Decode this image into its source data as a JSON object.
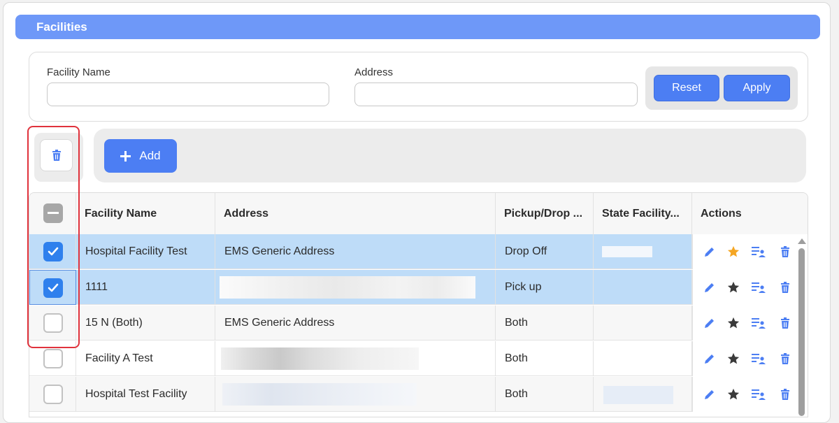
{
  "header": {
    "title": "Facilities"
  },
  "filters": {
    "facility_name_label": "Facility Name",
    "facility_name_value": "",
    "address_label": "Address",
    "address_value": "",
    "reset_label": "Reset",
    "apply_label": "Apply"
  },
  "toolbar": {
    "add_label": "Add"
  },
  "table": {
    "columns": [
      "Facility Name",
      "Address",
      "Pickup/Drop ...",
      "State Facility...",
      "Actions"
    ],
    "rows": [
      {
        "checked": true,
        "name": "Hospital Facility Test",
        "address": "EMS Generic Address",
        "pickup": "Drop Off",
        "favorite": true
      },
      {
        "checked": true,
        "name": "1111",
        "address": "",
        "pickup": "Pick up",
        "favorite": false
      },
      {
        "checked": false,
        "name": "15 N (Both)",
        "address": "EMS Generic Address",
        "pickup": "Both",
        "favorite": false
      },
      {
        "checked": false,
        "name": "Facility A Test",
        "address": "",
        "pickup": "Both",
        "favorite": false
      },
      {
        "checked": false,
        "name": "Hospital Test Facility",
        "address": "",
        "pickup": "Both",
        "favorite": false
      }
    ]
  },
  "colors": {
    "accent": "#4c7ef3",
    "title_bar": "#6e98f8",
    "selected_row": "#bedcf8",
    "favorite_star": "#f5a623",
    "highlight_border": "#e0323c"
  },
  "icons": {
    "delete": "trash-icon",
    "add": "plus-icon",
    "edit": "pencil-icon",
    "favorite": "star-icon",
    "assign": "user-list-icon"
  }
}
